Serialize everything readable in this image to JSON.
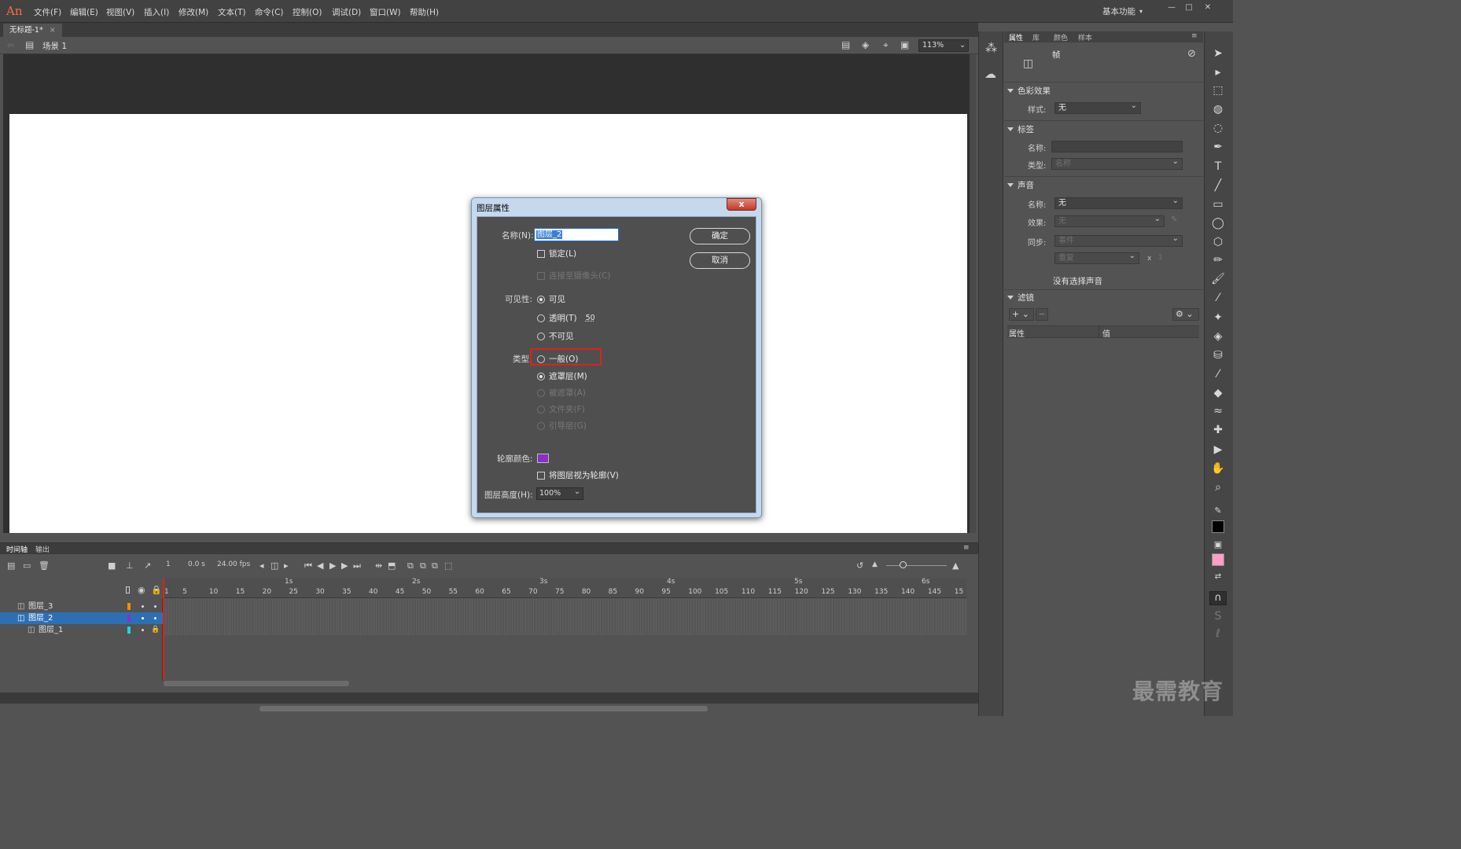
{
  "app": {
    "logo": "An"
  },
  "menu": [
    "文件(F)",
    "编辑(E)",
    "视图(V)",
    "插入(I)",
    "修改(M)",
    "文本(T)",
    "命令(C)",
    "控制(O)",
    "调试(D)",
    "窗口(W)",
    "帮助(H)"
  ],
  "workspace": "基本功能",
  "document": {
    "tab_title": "无标题-1*",
    "scene": "场景 1",
    "zoom": "113%"
  },
  "dialog": {
    "title": "图层属性",
    "name_label": "名称(N):",
    "name_value": "图层_2",
    "lock_label": "锁定(L)",
    "camera_label": "连接至摄像头(C)",
    "visibility_label": "可见性:",
    "visible": "可见",
    "transparent": "透明(T)",
    "transparency_value": "50",
    "invisible": "不可见",
    "type_label": "类型:",
    "type_normal": "一般(O)",
    "type_mask": "遮罩层(M)",
    "type_masked": "被遮罩(A)",
    "type_folder": "文件夹(F)",
    "type_guide": "引导层(G)",
    "outline_color_label": "轮廓颜色:",
    "outline_color": "#8b2fc9",
    "view_as_outline": "将图层视为轮廓(V)",
    "height_label": "图层高度(H):",
    "height_value": "100%",
    "ok": "确定",
    "cancel": "取消"
  },
  "properties": {
    "tabs": [
      "属性",
      "库",
      "颜色",
      "样本"
    ],
    "doc_type": "帧",
    "color_effect": {
      "header": "色彩效果",
      "style_label": "样式:",
      "style_value": "无"
    },
    "label": {
      "header": "标签",
      "name_label": "名称:",
      "name_value": "",
      "type_label": "类型:",
      "type_value": "名称"
    },
    "sound": {
      "header": "声音",
      "name_label": "名称:",
      "name_value": "无",
      "effect_label": "效果:",
      "effect_value": "无",
      "sync_label": "同步:",
      "sync_value": "事件",
      "repeat_value": "重复",
      "repeat_count_prefix": "x",
      "repeat_count": "1",
      "no_sound": "没有选择声音"
    },
    "filters": {
      "header": "滤镜",
      "col_property": "属性",
      "col_value": "值"
    }
  },
  "timeline": {
    "tabs": [
      "时间轴",
      "输出"
    ],
    "current_frame": "1",
    "time": "0.0 s",
    "fps": "24.00 fps",
    "seconds": [
      "1s",
      "2s",
      "3s",
      "4s",
      "5s",
      "6s"
    ],
    "ruler": [
      "1",
      "5",
      "10",
      "15",
      "20",
      "25",
      "30",
      "35",
      "40",
      "45",
      "50",
      "55",
      "60",
      "65",
      "70",
      "75",
      "80",
      "85",
      "90",
      "95",
      "100",
      "105",
      "110",
      "115",
      "120",
      "125",
      "130",
      "135",
      "140",
      "145",
      "15"
    ],
    "layers": [
      {
        "name": "图层_3",
        "color": "#ff8a00",
        "active": false
      },
      {
        "name": "图层_2",
        "color": "#8b2fc9",
        "active": true
      },
      {
        "name": "图层_1",
        "color": "#19d6e0",
        "active": false
      }
    ]
  },
  "watermark": "最需教育"
}
